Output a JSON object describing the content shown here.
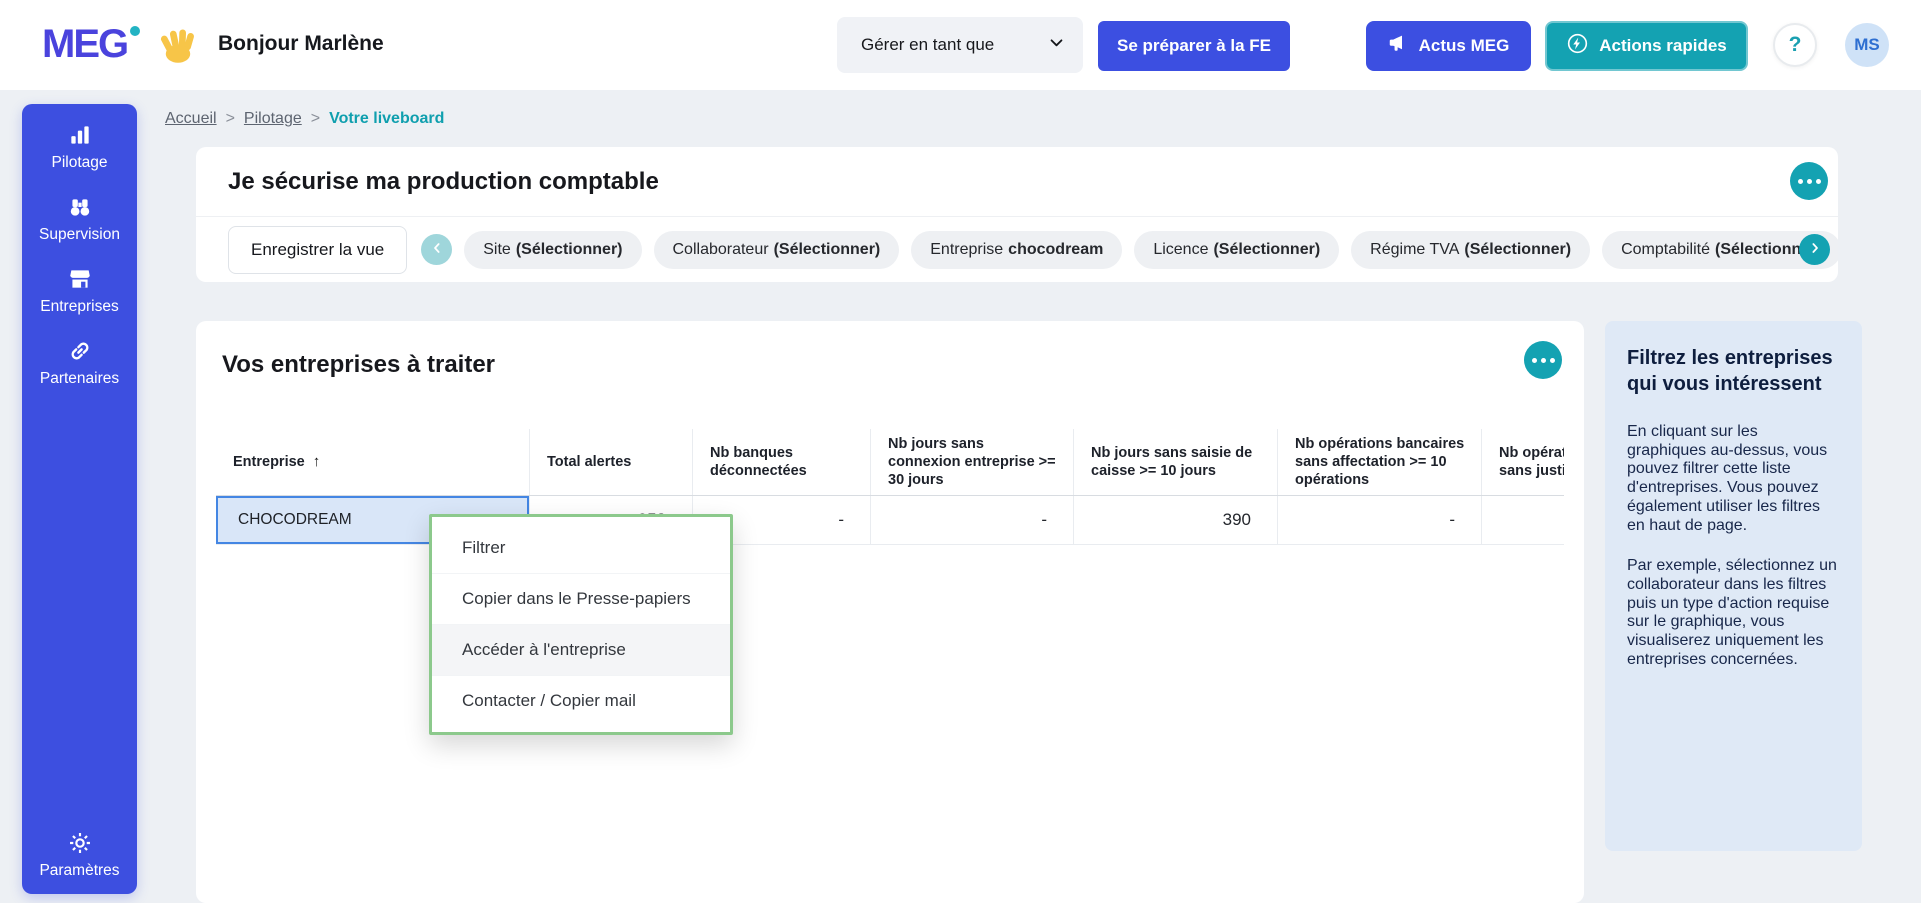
{
  "colors": {
    "primary_blue": "#3d4fe0",
    "accent_teal": "#14a2b2",
    "logo_purple": "#4a43dd",
    "selection_border": "#4486e3",
    "selection_bg": "#d9e6f8",
    "context_menu_border": "#8cc98c",
    "info_panel_bg": "#dfe9f6",
    "pill_bg": "#eef0f3",
    "page_bg": "#edf0f4",
    "avatar_bg": "#cfe2f7"
  },
  "icons": {
    "sidebar": [
      "bar-chart",
      "binoculars",
      "storefront",
      "link",
      "gear"
    ],
    "header": [
      "waving-hand",
      "chevron-down",
      "megaphone",
      "lightning",
      "question-mark"
    ],
    "misc": [
      "ellipsis",
      "sort-asc",
      "chevron-left",
      "chevron-right"
    ]
  },
  "header": {
    "logo": "MEG",
    "greeting": "Bonjour Marlène",
    "manage_as_label": "Gérer en tant que",
    "prepare_fe_label": "Se préparer à la FE",
    "actus_label": "Actus MEG",
    "quick_actions_label": "Actions rapides",
    "help_label": "?",
    "avatar_initials": "MS"
  },
  "sidebar": {
    "items": [
      {
        "label": "Pilotage",
        "icon": "bar-chart"
      },
      {
        "label": "Supervision",
        "icon": "binoculars"
      },
      {
        "label": "Entreprises",
        "icon": "storefront"
      },
      {
        "label": "Partenaires",
        "icon": "link"
      }
    ],
    "bottom_item": {
      "label": "Paramètres",
      "icon": "gear"
    }
  },
  "breadcrumb": {
    "home": "Accueil",
    "section": "Pilotage",
    "current": "Votre liveboard"
  },
  "liveboard": {
    "title": "Je sécurise ma production comptable",
    "save_view_label": "Enregistrer la vue",
    "filters": [
      {
        "label": "Site",
        "value": "(Sélectionner)"
      },
      {
        "label": "Collaborateur",
        "value": "(Sélectionner)"
      },
      {
        "label": "Entreprise",
        "value": "chocodream"
      },
      {
        "label": "Licence",
        "value": "(Sélectionner)"
      },
      {
        "label": "Régime TVA",
        "value": "(Sélectionner)"
      },
      {
        "label": "Comptabilité",
        "value": "(Sélectionner)"
      }
    ]
  },
  "entreprises_card": {
    "title": "Vos entreprises à traiter",
    "sort_icon": "↑",
    "columns": [
      "Entreprise",
      "Total alertes",
      "Nb banques déconnectées",
      "Nb jours sans connexion entreprise >= 30 jours",
      "Nb jours sans saisie de caisse >= 10 jours",
      "Nb opérations bancaires sans affectation >= 10 opérations",
      "Nb opérations bancaires sans justificatif"
    ],
    "row": {
      "entreprise": "CHOCODREAM",
      "total_alertes": "253",
      "nb_banques_deconnectees": "-",
      "nb_jours_sans_connexion": "-",
      "nb_jours_sans_saisie": "390",
      "nb_ops_sans_affectation": "-",
      "nb_ops_sans_justificatif": ""
    }
  },
  "context_menu": {
    "items": [
      {
        "label": "Filtrer"
      },
      {
        "label": "Copier dans le Presse-papiers"
      },
      {
        "label": "Accéder à l'entreprise"
      },
      {
        "label": "Contacter / Copier mail"
      }
    ]
  },
  "info_panel": {
    "title": "Filtrez les entreprises qui vous intéressent",
    "paragraph1": "En cliquant sur les graphiques au-dessus, vous pouvez filtrer cette liste d'entreprises. Vous pouvez également utiliser les filtres en haut de page.",
    "paragraph2": "Par exemple, sélectionnez un collaborateur dans les filtres puis un type d'action requise sur le graphique, vous visualiserez uniquement les entreprises concernées."
  }
}
